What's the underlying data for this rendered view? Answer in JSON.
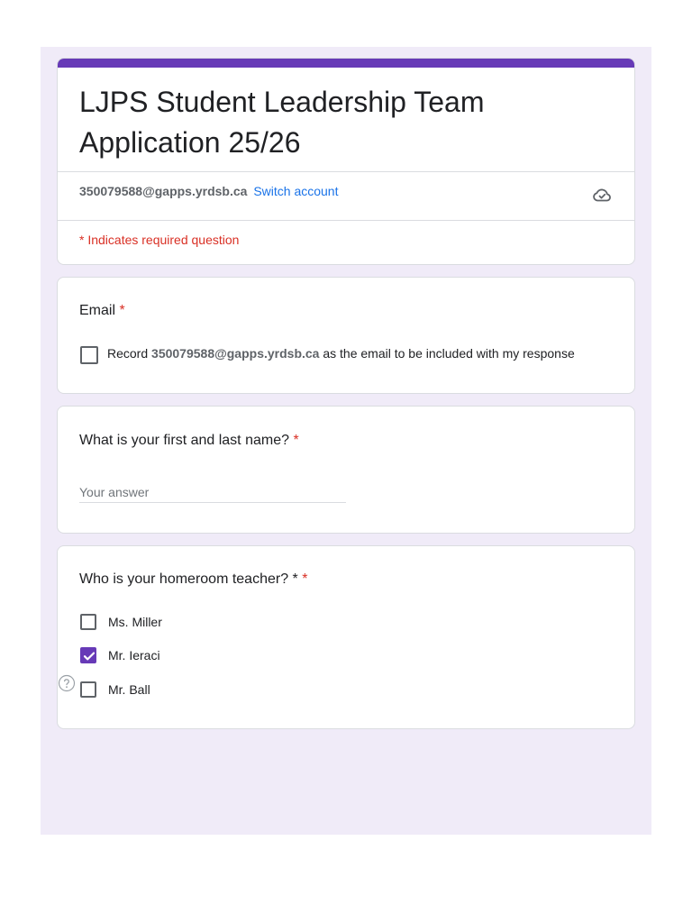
{
  "form": {
    "title": "LJPS Student Leadership Team Application 25/26",
    "accent_color": "#673ab7",
    "background_color": "#f0ebf8",
    "account_email": "350079588@gapps.yrdsb.ca",
    "switch_account_label": "Switch account",
    "cloud_icon": "cloud-saved-icon",
    "required_note": "* Indicates required question"
  },
  "email_question": {
    "title": "Email",
    "required_mark": "*",
    "record_prefix": "Record",
    "record_email": "350079588@gapps.yrdsb.ca",
    "record_suffix": "as the email to be included with my response",
    "checked": false
  },
  "name_question": {
    "title": "What is your first and last name?",
    "required_mark": "*",
    "value": "",
    "placeholder": "Your answer"
  },
  "homeroom_question": {
    "title": "Who is your homeroom teacher? *",
    "required_mark": "*",
    "options": [
      {
        "label": "Ms. Miller",
        "checked": false
      },
      {
        "label": "Mr. Ieraci",
        "checked": true
      },
      {
        "label": "Mr. Ball",
        "checked": false
      }
    ]
  },
  "help_icon": "help-circle-icon"
}
